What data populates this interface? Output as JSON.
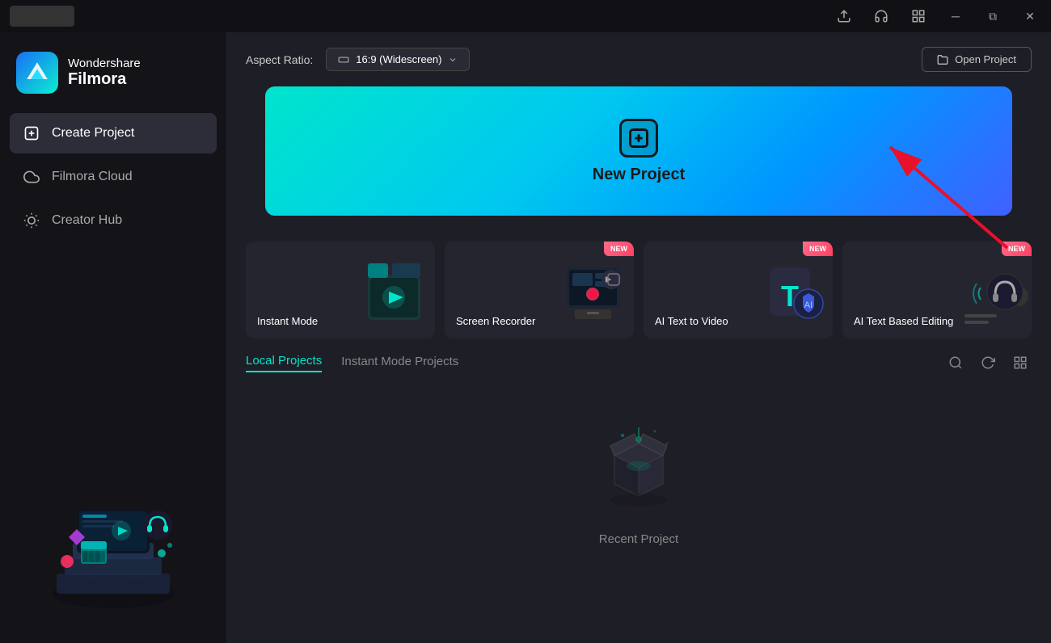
{
  "titlebar": {
    "minimize_label": "─",
    "maximize_label": "⧉",
    "close_label": "✕",
    "upload_icon": "upload-icon",
    "headphones_icon": "headphones-icon",
    "grid_icon": "grid-icon"
  },
  "sidebar": {
    "logo": {
      "line1": "Wondershare",
      "line2": "Filmora"
    },
    "items": [
      {
        "id": "create-project",
        "label": "Create Project",
        "icon": "plus-square",
        "active": true
      },
      {
        "id": "filmora-cloud",
        "label": "Filmora Cloud",
        "icon": "cloud",
        "active": false
      },
      {
        "id": "creator-hub",
        "label": "Creator Hub",
        "icon": "lightbulb",
        "active": false
      }
    ]
  },
  "header": {
    "aspect_ratio_label": "Aspect Ratio:",
    "aspect_ratio_value": "16:9 (Widescreen)",
    "open_project_label": "Open Project"
  },
  "new_project": {
    "icon": "+",
    "label": "New Project"
  },
  "feature_cards": [
    {
      "id": "instant-mode",
      "label": "Instant Mode",
      "badge": null
    },
    {
      "id": "screen-recorder",
      "label": "Screen Recorder",
      "badge": "NEW"
    },
    {
      "id": "ai-text-to-video",
      "label": "AI Text to Video",
      "badge": "NEW"
    },
    {
      "id": "ai-text-based-editing",
      "label": "AI Text Based Editing",
      "badge": "NEW"
    }
  ],
  "projects": {
    "tabs": [
      {
        "id": "local-projects",
        "label": "Local Projects",
        "active": true
      },
      {
        "id": "instant-mode-projects",
        "label": "Instant Mode Projects",
        "active": false
      }
    ],
    "search_icon": "search-icon",
    "refresh_icon": "refresh-icon",
    "view_icon": "view-icon",
    "empty_label": "Recent Project"
  },
  "colors": {
    "accent_teal": "#00e5cc",
    "accent_blue": "#0096ff",
    "badge_new": "#ff4060",
    "sidebar_bg": "#141418",
    "content_bg": "#1e1e26",
    "card_bg": "#252530"
  }
}
